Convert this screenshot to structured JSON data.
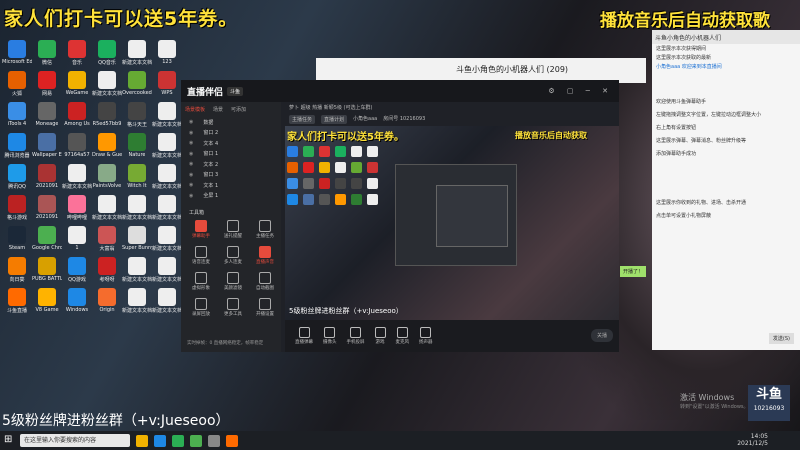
{
  "banners": {
    "left": "家人们打卡可以送5年券。",
    "right": "播放音乐后自动获取歌"
  },
  "desktop_icons": [
    {
      "label": "Microsoft Edge",
      "color": "#2a7de1"
    },
    {
      "label": "微信",
      "color": "#2bae54"
    },
    {
      "label": "音乐",
      "color": "#d33"
    },
    {
      "label": "QQ音乐",
      "color": "#1bb05e"
    },
    {
      "label": "新建文本文档",
      "color": "#eee"
    },
    {
      "label": "123",
      "color": "#eee"
    },
    {
      "label": "火狐",
      "color": "#e66000"
    },
    {
      "label": "网易",
      "color": "#d22"
    },
    {
      "label": "WeGame",
      "color": "#f2b200"
    },
    {
      "label": "新建文本文档",
      "color": "#eee"
    },
    {
      "label": "Overcooked",
      "color": "#6a3"
    },
    {
      "label": "WPS",
      "color": "#c33"
    },
    {
      "label": "iTools 4",
      "color": "#3a8ee6"
    },
    {
      "label": "Moneage",
      "color": "#666"
    },
    {
      "label": "Among Us",
      "color": "#c22"
    },
    {
      "label": "R5ed57bb9",
      "color": "#444"
    },
    {
      "label": "格斗天王",
      "color": "#444"
    },
    {
      "label": "新建文本文档",
      "color": "#eee"
    },
    {
      "label": "腾讯浏览器",
      "color": "#1e88e5"
    },
    {
      "label": "Wallpaper Engine",
      "color": "#4a6fa5"
    },
    {
      "label": "97164a57",
      "color": "#555"
    },
    {
      "label": "Draw & Guess",
      "color": "#ff9800"
    },
    {
      "label": "Nature",
      "color": "#2e7d32"
    },
    {
      "label": "新建文本文档",
      "color": "#eee"
    },
    {
      "label": "腾讯QQ",
      "color": "#1e9be9"
    },
    {
      "label": "2021091",
      "color": "#a33"
    },
    {
      "label": "新建文本文档",
      "color": "#eee"
    },
    {
      "label": "PaintsVolve",
      "color": "#8a8"
    },
    {
      "label": "Witch It",
      "color": "#7a3"
    },
    {
      "label": "新建文本文档",
      "color": "#eee"
    },
    {
      "label": "格斗游戏",
      "color": "#b22"
    },
    {
      "label": "2021091",
      "color": "#a55"
    },
    {
      "label": "哔哩哔哩",
      "color": "#fb7299"
    },
    {
      "label": "新建文本文档",
      "color": "#eee"
    },
    {
      "label": "新建文本文档",
      "color": "#eee"
    },
    {
      "label": "新建文本文档",
      "color": "#eee"
    },
    {
      "label": "Steam",
      "color": "#1b2838"
    },
    {
      "label": "Google Chrome",
      "color": "#4caf50"
    },
    {
      "label": "1",
      "color": "#eee"
    },
    {
      "label": "大富翁",
      "color": "#c55"
    },
    {
      "label": "Super Bunny Man",
      "color": "#ddd"
    },
    {
      "label": "新建文本文档",
      "color": "#eee"
    },
    {
      "label": "向日葵",
      "color": "#f57c00"
    },
    {
      "label": "PUBG BATTLEGROUNDS",
      "color": "#d8a000"
    },
    {
      "label": "QQ游戏",
      "color": "#1e88e5"
    },
    {
      "label": "考呀呀",
      "color": "#c22"
    },
    {
      "label": "新建文本文档",
      "color": "#eee"
    },
    {
      "label": "新建文本文档",
      "color": "#eee"
    },
    {
      "label": "斗鱼直播",
      "color": "#ff6a00"
    },
    {
      "label": "V8 Game",
      "color": "#ffb300"
    },
    {
      "label": "Windows",
      "color": "#1e88e5"
    },
    {
      "label": "Origin",
      "color": "#f56c2d"
    },
    {
      "label": "新建文本文档",
      "color": "#eee"
    },
    {
      "label": "新建文本文档",
      "color": "#eee"
    }
  ],
  "bottom_caption": "5级粉丝牌进粉丝群（+v:Jueseoo）",
  "taskbar": {
    "start": "⊞",
    "search_placeholder": "在这里输入你要搜索的内容",
    "apps": [
      "#f2b200",
      "#1e88e5",
      "#2bae54",
      "#4caf50",
      "#888",
      "#ff6a00"
    ],
    "time": "14:05",
    "date": "2021/12/5"
  },
  "watermark": {
    "line1": "激活 Windows",
    "line2": "转到\"设置\"以激活 Windows。"
  },
  "douyu": {
    "logo": "斗鱼",
    "room_id": "10216093"
  },
  "chat_window": {
    "title": "斗鱼小角色的小机器人们 (209)"
  },
  "chat_side": {
    "header": "斗鱼小角色的小机器人们",
    "lines": [
      "这里展示本次获得期间",
      "这里展示本次获取的最新"
    ],
    "user": "小角色aaa 欢迎来到本直播间",
    "bubbles": [
      "欢迎使用斗鱼弹幕助手",
      "左键拖拽调整文字位置，左键拉动边框调整大小",
      "右上角有设置按钮",
      "这里展示弹幕、弹幕消息、粉丝牌升级等",
      "添加弹幕助手成功",
      "这里展示你收到的礼物、进场、击杀开通",
      "点击单可设置小礼物屏蔽"
    ],
    "send": "发送(S)",
    "green_msg": "开播了！"
  },
  "obs": {
    "logo": "直播伴侣",
    "tag": "斗鱼",
    "win_buttons": "⚙ ▢ ─ ✕",
    "tabs": [
      "场景模板",
      "场景",
      "可添加"
    ],
    "sources": [
      "数据",
      "窗口 2",
      "文本 4",
      "窗口 1",
      "文本 2",
      "窗口 3",
      "文本 1",
      "全屏 1"
    ],
    "tools_title": "工具箱",
    "tools": [
      {
        "label": "弹幕助手",
        "red": true
      },
      {
        "label": "送礼提醒",
        "red": false
      },
      {
        "label": "主播任务",
        "red": false
      },
      {
        "label": "语音连麦",
        "red": false
      },
      {
        "label": "多人连麦",
        "red": false
      },
      {
        "label": "直播声音",
        "red": true
      },
      {
        "label": "虚拟形象",
        "red": false
      },
      {
        "label": "美颜滤镜",
        "red": false
      },
      {
        "label": "自动截图",
        "red": false
      },
      {
        "label": "录屏回放",
        "red": false
      },
      {
        "label": "更多工具",
        "red": false
      },
      {
        "label": "开播设置",
        "red": false
      }
    ],
    "footer": "实时掉帧：0   直播网络稳定，帧率稳定",
    "info_row1": "萝卜 超级 热播 新颖5级 (可选上车群)",
    "info_tags": [
      "主播任务",
      "直播计划",
      "小角色aaa",
      "房间号 10216093"
    ],
    "bottom_buttons": [
      "直播弹幕",
      "摄像头",
      "手机投屏",
      "游戏",
      "麦克风",
      "扬声器"
    ],
    "start_live": "关播"
  },
  "preview": {
    "banner_left": "家人们打卡可以送5年券。",
    "banner_right": "播放音乐后自动获取",
    "caption": "5级粉丝牌进粉丝群（+v:Jueseoo）",
    "mini_colors": [
      "#2a7de1",
      "#2bae54",
      "#d33",
      "#1bb05e",
      "#eee",
      "#eee",
      "#e66000",
      "#d22",
      "#f2b200",
      "#eee",
      "#6a3",
      "#c33",
      "#3a8ee6",
      "#666",
      "#c22",
      "#444",
      "#444",
      "#eee",
      "#1e88e5",
      "#4a6fa5",
      "#555",
      "#ff9800",
      "#2e7d32",
      "#eee"
    ]
  }
}
